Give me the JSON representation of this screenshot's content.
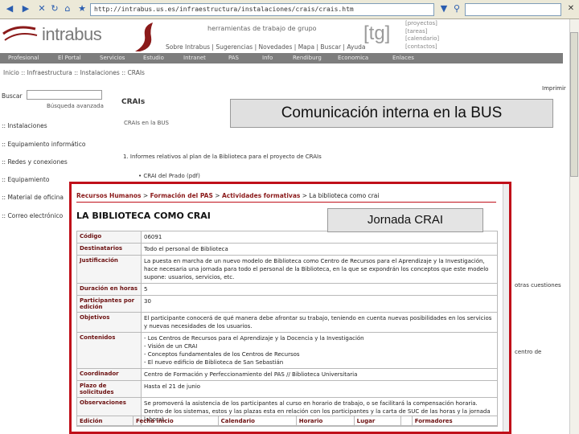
{
  "browser": {
    "address": "http://intrabus.us.es/infraestructura/instalaciones/crais/crais.htm"
  },
  "header": {
    "logo_text": "intrabus",
    "subtitle": "herramientas de trabajo de grupo",
    "nav": "Sobre Intrabus | Sugerencias | Novedades | Mapa | Buscar | Ayuda",
    "tg": "[tg]",
    "tg_links": [
      "[proyectos]",
      "[tareas]",
      "[calendario]",
      "[contactos]"
    ]
  },
  "mainnav": {
    "items": [
      "Profesional",
      "El Portal",
      "Servicios",
      "Estudio",
      "Intranet",
      "PAS",
      "Info",
      "Rendiburg",
      "Economica",
      "Enlaces"
    ]
  },
  "breadcrumb": "Inicio :: Infraestructura :: Instalaciones :: CRAIs",
  "sidebar": {
    "search_label": "Buscar",
    "advanced_search": "Búsqueda avanzada",
    "items": [
      ":: Instalaciones",
      ":: Equipamiento informático",
      ":: Redes y conexiones",
      ":: Equipamiento",
      ":: Material de oficina",
      ":: Correo electrónico"
    ]
  },
  "content": {
    "print": "Imprimir",
    "title": "CRAIs",
    "subtitle": "CRAIs en la BUS",
    "intro": "1. Informes relativos al plan de la Biblioteca para el proyecto de CRAIs",
    "crai_prado": "• CRAI del Prado (pdf)",
    "right_fragment_1": "otras cuestiones",
    "right_fragment_2": "centro de"
  },
  "banner": "Comunicación interna en la BUS",
  "inner": {
    "breadcrumb_parts": [
      "Recursos Humanos",
      "Formación del PAS",
      "Actividades formativas"
    ],
    "breadcrumb_last": "La biblioteca como crai",
    "title": "LA BIBLIOTECA COMO CRAI",
    "jornada": "Jornada CRAI",
    "rows": [
      {
        "label": "Código",
        "value": "06091"
      },
      {
        "label": "Destinatarios",
        "value": "Todo el personal de Biblioteca"
      },
      {
        "label": "Justificación",
        "value": "La puesta en marcha de un nuevo modelo de Biblioteca como Centro de Recursos para el Aprendizaje y la Investigación, hace necesaria una jornada para todo el personal de la Biblioteca, en la que se expondrán los conceptos que este modelo supone: usuarios, servicios, etc."
      },
      {
        "label": "Duración en horas",
        "value": "5"
      },
      {
        "label": "Participantes por edición",
        "value": "30"
      },
      {
        "label": "Objetivos",
        "value": "El participante conocerá de qué manera debe afrontar su trabajo, teniendo en cuenta nuevas posibilidades en los servicios y nuevas necesidades de los usuarios."
      },
      {
        "label": "Contenidos",
        "value": "- Los Centros de Recursos para el Aprendizaje y la Docencia y la Investigación\n- Visión de un CRAI\n- Conceptos fundamentales de los Centros de Recursos\n- El nuevo edificio de Biblioteca de San Sebastián"
      },
      {
        "label": "Coordinador",
        "value": "Centro de Formación y Perfeccionamiento del PAS // Biblioteca Universitaria"
      },
      {
        "label": "Plazo de solicitudes",
        "value": "Hasta el 21 de junio"
      },
      {
        "label": "Observaciones",
        "value": "Se promoverá la asistencia de los participantes al curso en horario de trabajo, o se facilitará la compensación horaria. Dentro de los sistemas, estos y las plazas esta en relación con los participantes y la carta de SUC de las horas y la jornada laboral."
      }
    ],
    "bottom_headers": [
      "Edición",
      "Fecha inicio",
      "Calendario",
      "Horario",
      "Lugar",
      "",
      "Formadores"
    ]
  },
  "colors": {
    "frame_red": "#c0101a",
    "label_color": "#6b1010",
    "nav_gray": "#7d7d7d"
  },
  "icons": [
    "back-arrow-icon",
    "forward-arrow-icon",
    "refresh-icon",
    "stop-icon",
    "home-icon",
    "search-icon",
    "print-icon",
    "favorites-icon",
    "go-icon",
    "close-icon",
    "logo-swirl-icon"
  ]
}
